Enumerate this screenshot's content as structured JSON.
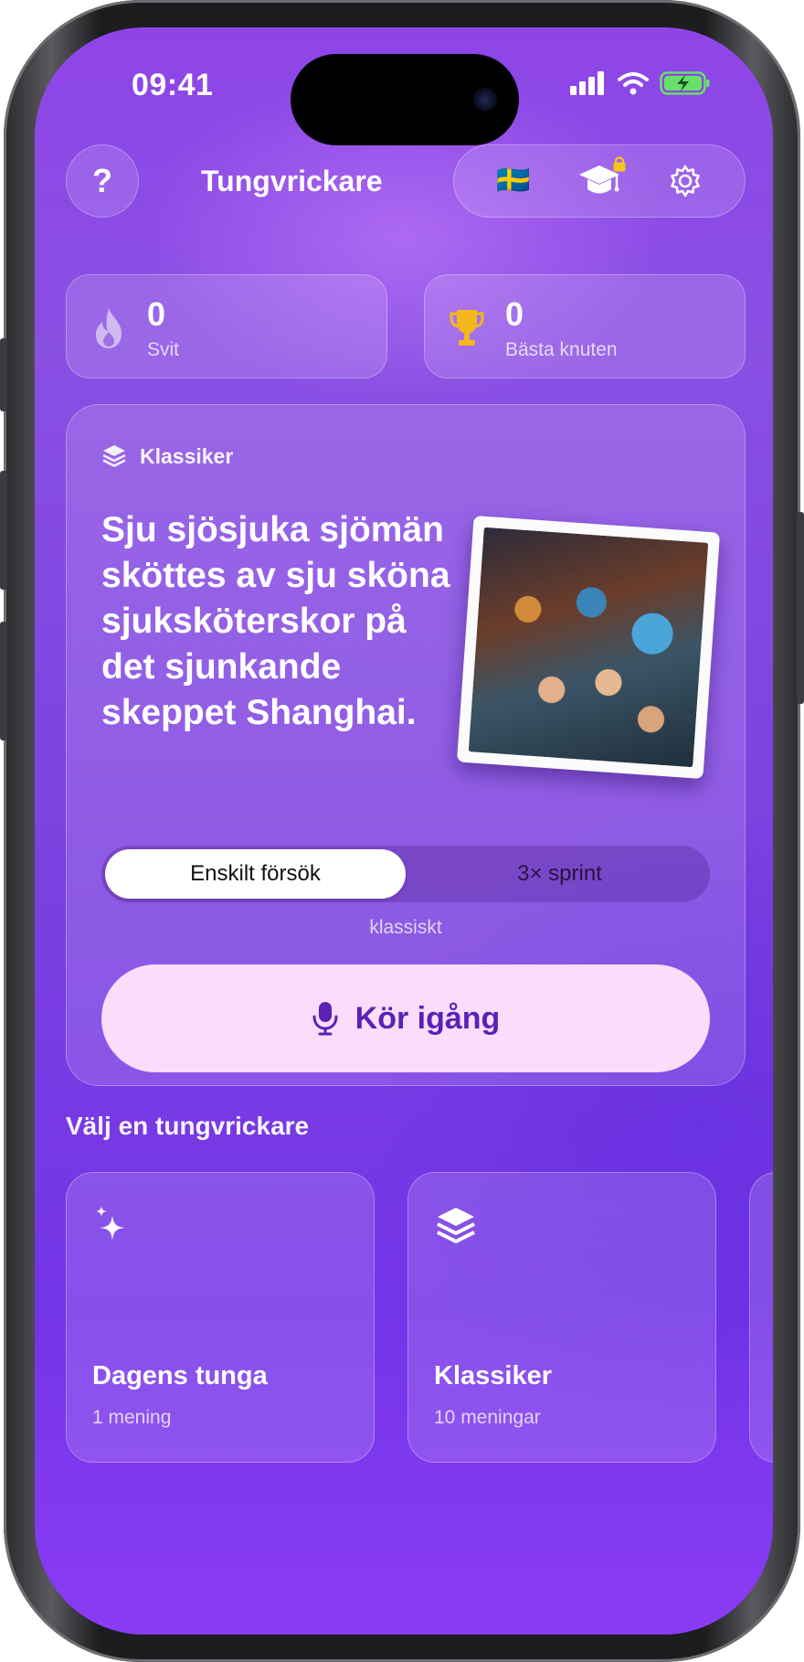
{
  "status_bar": {
    "time": "09:41"
  },
  "header": {
    "title": "Tungvrickare",
    "help_label": "?",
    "language_flag": "🇸🇪"
  },
  "stats": [
    {
      "value": "0",
      "label": "Svit",
      "icon": "flame-icon"
    },
    {
      "value": "0",
      "label": "Bästa knuten",
      "icon": "trophy-icon"
    }
  ],
  "featured": {
    "category": "Klassiker",
    "sentence": "Sju sjösjuka sjömän sköttes av sju sköna sjuksköterskor på det sjunkande skeppet Shanghai.",
    "modes": [
      "Enskilt försök",
      "3× sprint"
    ],
    "selected_mode": "Enskilt försök",
    "mode_note": "klassiskt",
    "start_label": "Kör igång"
  },
  "section_title": "Välj en tungvrickare",
  "tiles": [
    {
      "name": "Dagens tunga",
      "count": "1 mening",
      "icon": "sparkles-icon"
    },
    {
      "name": "Klassiker",
      "count": "10 meningar",
      "icon": "layers-icon"
    }
  ],
  "colors": {
    "background": "#8a4fe3",
    "start_button_bg": "#fbdcfb",
    "start_button_text": "#5b21b6",
    "trophy": "#f5b81c"
  }
}
